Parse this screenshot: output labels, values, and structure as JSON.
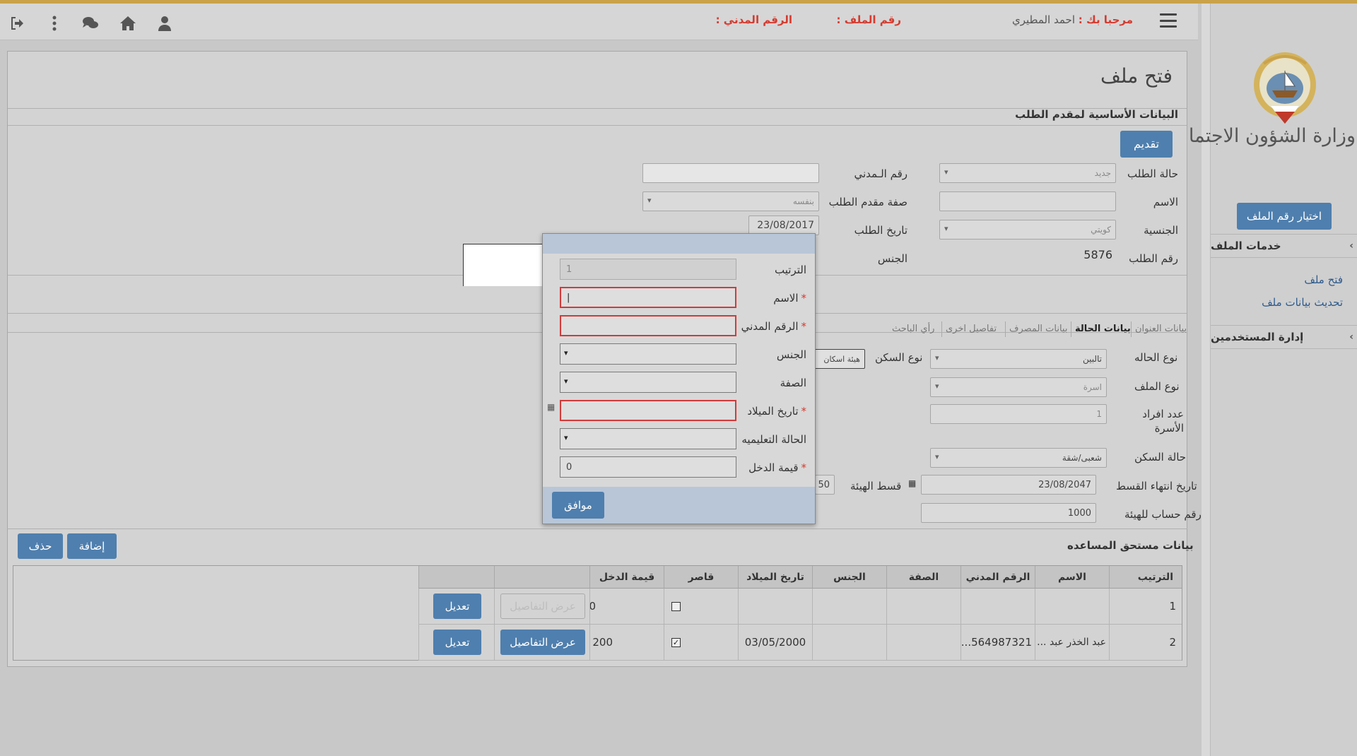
{
  "header": {
    "welcome_label": "مرحبا بك :",
    "user_name": "احمد المطيري",
    "file_no_label": "رقم الملف :",
    "civil_id_label": "الرقم المدني :",
    "icons": [
      "menu-icon",
      "user-icon",
      "home-icon",
      "chat-icon",
      "more-icon",
      "logout-icon"
    ]
  },
  "sidebar": {
    "ministry": "وزارة الشؤون الاجتماعية",
    "choose_file_button": "اختيار رقم الملف",
    "sections": [
      {
        "title": "خدمات الملف",
        "items": [
          "فتح ملف",
          "تحديث بيانات ملف"
        ]
      },
      {
        "title": "إدارة المستخدمين",
        "items": []
      }
    ]
  },
  "main": {
    "title": "فتح ملف",
    "basic_section": "البيانات الأساسية لمقدم الطلب",
    "submit_button": "تقديم",
    "fields": {
      "request_status_label": "حالة الطلب",
      "request_status_value": "جديد",
      "civil_no_label": "رقم الـمدني",
      "name_label": "الاسم",
      "applicant_type_label": "صفة مقدم الطلب",
      "applicant_type_value": "بنفسه",
      "nationality_label": "الجنسية",
      "nationality_value": "كويتي",
      "request_date_label": "تاريخ الطلب",
      "request_date_value": "23/08/2017",
      "request_no_label": "رقم الطلب",
      "request_no_value": "5876",
      "gender_label": "الجنس"
    },
    "tabs": [
      "بيانات العنوان",
      "بيانات الحالة",
      "بيانات المصرف",
      "تفاصيل اخرى",
      "رأي الباحث"
    ],
    "active_tab": "بيانات الحالة",
    "case": {
      "case_type_label": "نوع الحاله",
      "case_type_value": "تالبين",
      "housing_type_label": "نوع السكن",
      "housing_type_value": "هيئة اسكان",
      "file_type_label": "نوع الملف",
      "file_type_value": "اسرة",
      "family_count_label": "عدد افراد الأسرة",
      "family_count_value": "1",
      "housing_status_label": "حالة السكن",
      "housing_status_value": "شعبى/شقة",
      "installment_end_label": "تاريخ انتهاء القسط",
      "installment_end_value": "23/08/2047",
      "authority_installment_label": "قسط الهيئة",
      "authority_installment_value": "50",
      "authority_account_label": "رقم حساب للهيئة",
      "authority_account_value": "1000"
    },
    "beneficiaries": {
      "title": "بيانات مستحق المساعده",
      "add_button": "إضافة",
      "delete_button": "حذف",
      "columns": [
        "الترتيب",
        "الاسم",
        "الرقم المدني",
        "الصفة",
        "الجنس",
        "تاريخ الميلاد",
        "قاصر",
        "قيمة الدخل"
      ],
      "rows": [
        {
          "order": "1",
          "name": "",
          "civil": "",
          "role": "",
          "gender": "",
          "dob": "",
          "minor": false,
          "income": "0",
          "details": "عرض التفاصيل",
          "edit": "تعديل"
        },
        {
          "order": "2",
          "name": "عبد الخذر عبد ...",
          "civil": "564987321...",
          "role": "",
          "gender": "",
          "dob": "03/05/2000",
          "minor": true,
          "income": "200",
          "details": "عرض التفاصيل",
          "edit": "تعديل"
        }
      ]
    }
  },
  "modal": {
    "order_label": "الترتيب",
    "order_value": "1",
    "name_label": "الاسم",
    "civil_label": "الرقم المدني",
    "gender_label": "الجنس",
    "role_label": "الصفة",
    "dob_label": "تاريخ الميلاد",
    "education_label": "الحالة التعليميه",
    "income_label": "قيمة الدخل",
    "income_value": "0",
    "required_mark": "*",
    "ok_button": "موافق"
  },
  "colors": {
    "accent": "#4f7fae",
    "required": "#d63b2f",
    "gold": "#c9a24a",
    "link": "#2f5b8c"
  }
}
